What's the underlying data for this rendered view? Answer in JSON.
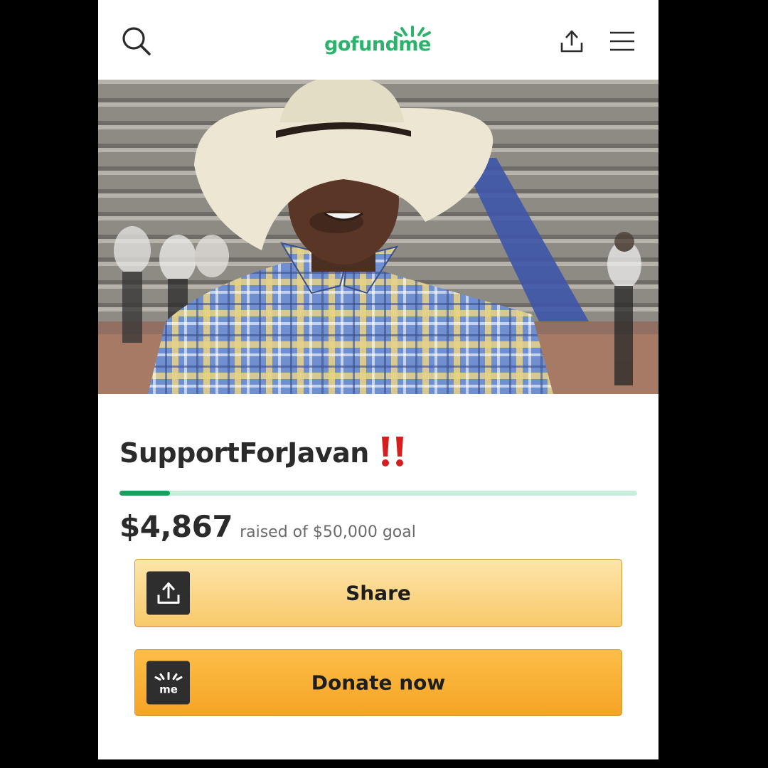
{
  "header": {
    "logo_text": "gofundme",
    "icons": [
      "search-icon",
      "share-icon",
      "menu-icon"
    ]
  },
  "hero": {
    "image": "man-in-white-cowboy-hat-plaid-shirt-stadium"
  },
  "campaign": {
    "title": "SupportForJavan",
    "title_emoji": "double-exclamation",
    "amount_raised": "$4,867",
    "goal_text": "raised of $50,000 goal",
    "progress_fraction": 0.0973
  },
  "actions": {
    "share_label": "Share",
    "donate_label": "Donate now",
    "donate_icon_text": "me"
  },
  "colors": {
    "brand_green": "#2bb36b",
    "progress_fill": "#1f9d5c",
    "progress_track": "#c7eedb",
    "share_button": "#f9c96a",
    "donate_button": "#f5a425"
  }
}
